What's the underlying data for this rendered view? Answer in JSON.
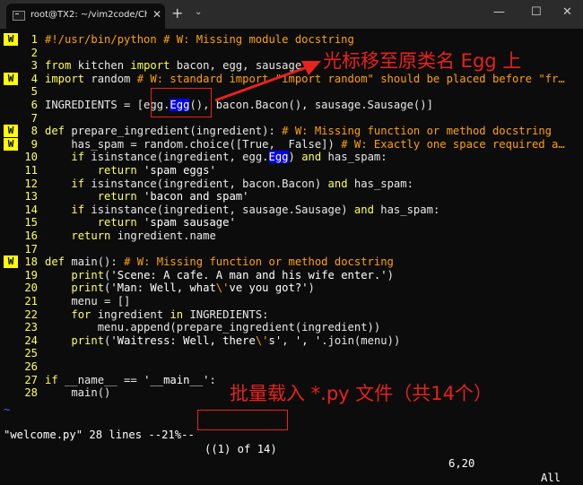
{
  "window": {
    "tab_title": "root@TX2: ~/vim2code/Chapt",
    "tab_close": "✕",
    "new_tab": "+",
    "dropdown": "⌄",
    "minimize": "—",
    "maximize": "☐",
    "close": "✕"
  },
  "sign_text": "W",
  "lines": [
    {
      "n": "1",
      "sign": true,
      "parts": [
        {
          "t": "#!/usr/bin/python # W: Missing module docstring",
          "c": "cm"
        }
      ]
    },
    {
      "n": "2",
      "sign": false,
      "parts": []
    },
    {
      "n": "3",
      "sign": false,
      "parts": [
        {
          "t": "from",
          "c": "kw"
        },
        {
          "t": " kitchen ",
          "c": ""
        },
        {
          "t": "import",
          "c": "kw"
        },
        {
          "t": " bacon, egg, sausage",
          "c": ""
        }
      ]
    },
    {
      "n": "4",
      "sign": true,
      "parts": [
        {
          "t": "import",
          "c": "kw"
        },
        {
          "t": " random ",
          "c": ""
        },
        {
          "t": "# W: standard import \"import random\" should be placed before \"fr…",
          "c": "cm"
        }
      ]
    },
    {
      "n": "5",
      "sign": false,
      "parts": []
    },
    {
      "n": "6",
      "sign": false,
      "parts": [
        {
          "t": "INGREDIENTS = [egg.",
          "c": ""
        },
        {
          "t": "Egg",
          "c": "sel"
        },
        {
          "t": "(), bacon.Bacon(), sausage.Sausage()]",
          "c": ""
        }
      ]
    },
    {
      "n": "7",
      "sign": false,
      "parts": []
    },
    {
      "n": "8",
      "sign": true,
      "parts": [
        {
          "t": "def",
          "c": "kw"
        },
        {
          "t": " prepare_ingredient(ingredient): ",
          "c": ""
        },
        {
          "t": "# W: Missing function or method docstring",
          "c": "cm"
        }
      ]
    },
    {
      "n": "9",
      "sign": true,
      "parts": [
        {
          "t": "    has_spam = random.choice([True,  False]) ",
          "c": ""
        },
        {
          "t": "# W: Exactly one space required a…",
          "c": "cm"
        }
      ]
    },
    {
      "n": "10",
      "sign": false,
      "parts": [
        {
          "t": "    ",
          "c": ""
        },
        {
          "t": "if",
          "c": "kw"
        },
        {
          "t": " isinstance(ingredient, egg.",
          "c": ""
        },
        {
          "t": "Egg",
          "c": "sel"
        },
        {
          "t": ") ",
          "c": ""
        },
        {
          "t": "and",
          "c": "kw"
        },
        {
          "t": " has_spam:",
          "c": ""
        }
      ]
    },
    {
      "n": "11",
      "sign": false,
      "parts": [
        {
          "t": "        ",
          "c": ""
        },
        {
          "t": "return",
          "c": "kw"
        },
        {
          "t": " 'spam eggs'",
          "c": "str"
        }
      ]
    },
    {
      "n": "12",
      "sign": false,
      "parts": [
        {
          "t": "    ",
          "c": ""
        },
        {
          "t": "if",
          "c": "kw"
        },
        {
          "t": " isinstance(ingredient, bacon.Bacon) ",
          "c": ""
        },
        {
          "t": "and",
          "c": "kw"
        },
        {
          "t": " has_spam:",
          "c": ""
        }
      ]
    },
    {
      "n": "13",
      "sign": false,
      "parts": [
        {
          "t": "        ",
          "c": ""
        },
        {
          "t": "return",
          "c": "kw"
        },
        {
          "t": " 'bacon and spam'",
          "c": "str"
        }
      ]
    },
    {
      "n": "14",
      "sign": false,
      "parts": [
        {
          "t": "    ",
          "c": ""
        },
        {
          "t": "if",
          "c": "kw"
        },
        {
          "t": " isinstance(ingredient, sausage.Sausage) ",
          "c": ""
        },
        {
          "t": "and",
          "c": "kw"
        },
        {
          "t": " has_spam:",
          "c": ""
        }
      ]
    },
    {
      "n": "15",
      "sign": false,
      "parts": [
        {
          "t": "        ",
          "c": ""
        },
        {
          "t": "return",
          "c": "kw"
        },
        {
          "t": " 'spam sausage'",
          "c": "str"
        }
      ]
    },
    {
      "n": "16",
      "sign": false,
      "parts": [
        {
          "t": "    ",
          "c": ""
        },
        {
          "t": "return",
          "c": "kw"
        },
        {
          "t": " ingredient.name",
          "c": ""
        }
      ]
    },
    {
      "n": "17",
      "sign": false,
      "parts": []
    },
    {
      "n": "18",
      "sign": true,
      "parts": [
        {
          "t": "def",
          "c": "kw"
        },
        {
          "t": " main(): ",
          "c": ""
        },
        {
          "t": "# W: Missing function or method docstring",
          "c": "cm"
        }
      ]
    },
    {
      "n": "19",
      "sign": false,
      "parts": [
        {
          "t": "    ",
          "c": ""
        },
        {
          "t": "print",
          "c": "kw"
        },
        {
          "t": "(",
          "c": ""
        },
        {
          "t": "'Scene: A cafe. A man and his wife enter.'",
          "c": "str"
        },
        {
          "t": ")",
          "c": ""
        }
      ]
    },
    {
      "n": "20",
      "sign": false,
      "parts": [
        {
          "t": "    ",
          "c": ""
        },
        {
          "t": "print",
          "c": "kw"
        },
        {
          "t": "(",
          "c": ""
        },
        {
          "t": "'Man: Well, what",
          "c": "str"
        },
        {
          "t": "\\'",
          "c": "cm"
        },
        {
          "t": "ve you got?'",
          "c": "str"
        },
        {
          "t": ")",
          "c": ""
        }
      ]
    },
    {
      "n": "21",
      "sign": false,
      "parts": [
        {
          "t": "    menu = []",
          "c": ""
        }
      ]
    },
    {
      "n": "22",
      "sign": false,
      "parts": [
        {
          "t": "    ",
          "c": ""
        },
        {
          "t": "for",
          "c": "kw"
        },
        {
          "t": " ingredient ",
          "c": ""
        },
        {
          "t": "in",
          "c": "kw"
        },
        {
          "t": " INGREDIENTS:",
          "c": ""
        }
      ]
    },
    {
      "n": "23",
      "sign": false,
      "parts": [
        {
          "t": "        menu.append(prepare_ingredient(ingredient))",
          "c": ""
        }
      ]
    },
    {
      "n": "24",
      "sign": false,
      "parts": [
        {
          "t": "    ",
          "c": ""
        },
        {
          "t": "print",
          "c": "kw"
        },
        {
          "t": "(",
          "c": ""
        },
        {
          "t": "'Waitress: Well, there",
          "c": "str"
        },
        {
          "t": "\\'",
          "c": "cm"
        },
        {
          "t": "s'",
          "c": "str"
        },
        {
          "t": ", ",
          "c": ""
        },
        {
          "t": "', '",
          "c": "str"
        },
        {
          "t": ".join(menu))",
          "c": ""
        }
      ]
    },
    {
      "n": "25",
      "sign": false,
      "parts": []
    },
    {
      "n": "26",
      "sign": false,
      "parts": []
    },
    {
      "n": "27",
      "sign": false,
      "parts": [
        {
          "t": "if",
          "c": "kw"
        },
        {
          "t": " __name__ == ",
          "c": ""
        },
        {
          "t": "'__main__'",
          "c": "str"
        },
        {
          "t": ":",
          "c": ""
        }
      ]
    },
    {
      "n": "28",
      "sign": false,
      "parts": [
        {
          "t": "    main()",
          "c": ""
        }
      ]
    }
  ],
  "tilde": "~",
  "status": {
    "file": "\"welcome.py\" 28 lines --21%--",
    "quickfix": "((1) of 14)",
    "position": "6,20",
    "scroll": "All"
  },
  "annotations": {
    "top": "光标移至原类名 Egg 上",
    "bottom": "批量载入 *.py 文件（共14个）"
  }
}
